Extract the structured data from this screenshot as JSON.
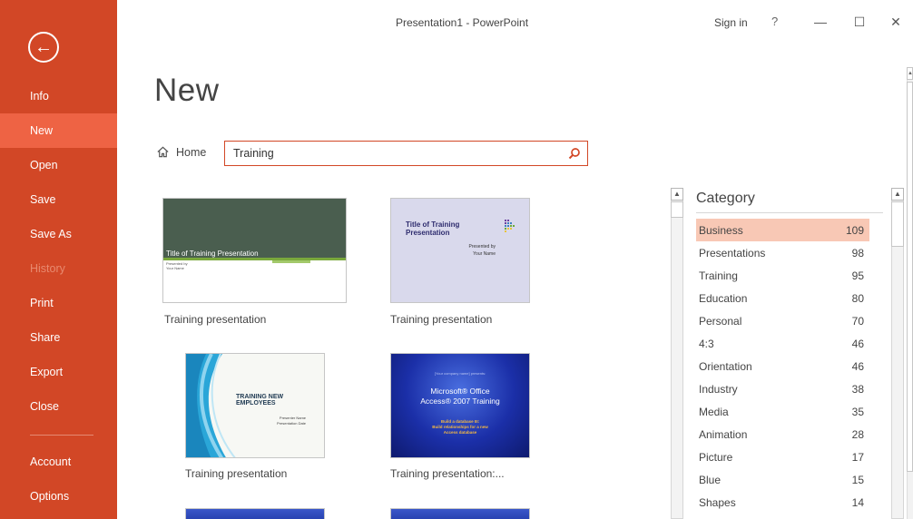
{
  "window": {
    "title": "Presentation1 - PowerPoint",
    "sign_in": "Sign in",
    "help": "?",
    "minimize": "—",
    "maximize": "☐",
    "close": "✕"
  },
  "sidebar": {
    "back_icon": "back-arrow-icon",
    "items": [
      {
        "label": "Info",
        "state": "normal"
      },
      {
        "label": "New",
        "state": "selected"
      },
      {
        "label": "Open",
        "state": "normal"
      },
      {
        "label": "Save",
        "state": "normal"
      },
      {
        "label": "Save As",
        "state": "normal"
      },
      {
        "label": "History",
        "state": "disabled"
      },
      {
        "label": "Print",
        "state": "normal"
      },
      {
        "label": "Share",
        "state": "normal"
      },
      {
        "label": "Export",
        "state": "normal"
      },
      {
        "label": "Close",
        "state": "normal"
      },
      {
        "label": "Account",
        "state": "normal"
      },
      {
        "label": "Options",
        "state": "normal"
      }
    ]
  },
  "main": {
    "heading": "New",
    "home_label": "Home",
    "search": {
      "value": "Training",
      "placeholder": ""
    },
    "templates": [
      {
        "caption": "Training presentation",
        "thumb_title": "Title of Training Presentation",
        "thumb_sub_1": "Presented by",
        "thumb_sub_2": "Your Name"
      },
      {
        "caption": "Training presentation",
        "thumb_title_1": "Title of Training",
        "thumb_title_2": "Presentation",
        "thumb_sub_1": "Presented by",
        "thumb_sub_2": "Your Name"
      },
      {
        "caption": "Training presentation",
        "thumb_title": "Training New Employees",
        "thumb_sub_1": "Presenter Name",
        "thumb_sub_2": "Presentation Date"
      },
      {
        "caption": "Training presentation:...",
        "thumb_top": "[Your company name] presents:",
        "thumb_title_1": "Microsoft® Office",
        "thumb_title_2": "Access® 2007 Training",
        "thumb_sub_1": "Build a database III:",
        "thumb_sub_2": "Build relationships for a new",
        "thumb_sub_3": "Access database"
      }
    ]
  },
  "category": {
    "heading": "Category",
    "items": [
      {
        "name": "Business",
        "count": "109",
        "selected": true
      },
      {
        "name": "Presentations",
        "count": "98"
      },
      {
        "name": "Training",
        "count": "95"
      },
      {
        "name": "Education",
        "count": "80"
      },
      {
        "name": "Personal",
        "count": "70"
      },
      {
        "name": "4:3",
        "count": "46"
      },
      {
        "name": "Orientation",
        "count": "46"
      },
      {
        "name": "Industry",
        "count": "38"
      },
      {
        "name": "Media",
        "count": "35"
      },
      {
        "name": "Animation",
        "count": "28"
      },
      {
        "name": "Picture",
        "count": "17"
      },
      {
        "name": "Blue",
        "count": "15"
      },
      {
        "name": "Shapes",
        "count": "14"
      }
    ]
  },
  "colors": {
    "backstage_accent": "#d24726",
    "selected_nav": "#ee6344",
    "selected_category": "#f8c8b5"
  }
}
